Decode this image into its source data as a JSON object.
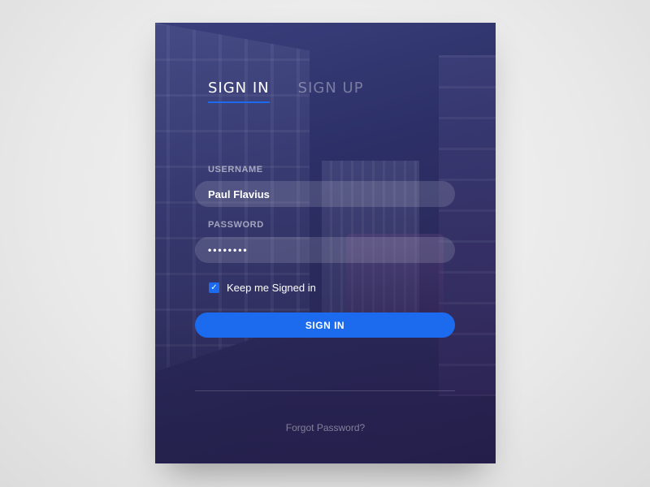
{
  "tabs": {
    "sign_in": "SIGN IN",
    "sign_up": "SIGN UP"
  },
  "form": {
    "username_label": "USERNAME",
    "username_value": "Paul Flavius",
    "password_label": "PASSWORD",
    "password_value": "••••••••",
    "remember_label": "Keep me Signed in",
    "remember_checked": true,
    "checkmark": "✓",
    "submit_label": "SIGN IN"
  },
  "footer": {
    "forgot_label": "Forgot Password?"
  },
  "colors": {
    "accent": "#1c6bef",
    "card_top": "#3a3f7c",
    "card_bottom": "#2a1f4e"
  }
}
